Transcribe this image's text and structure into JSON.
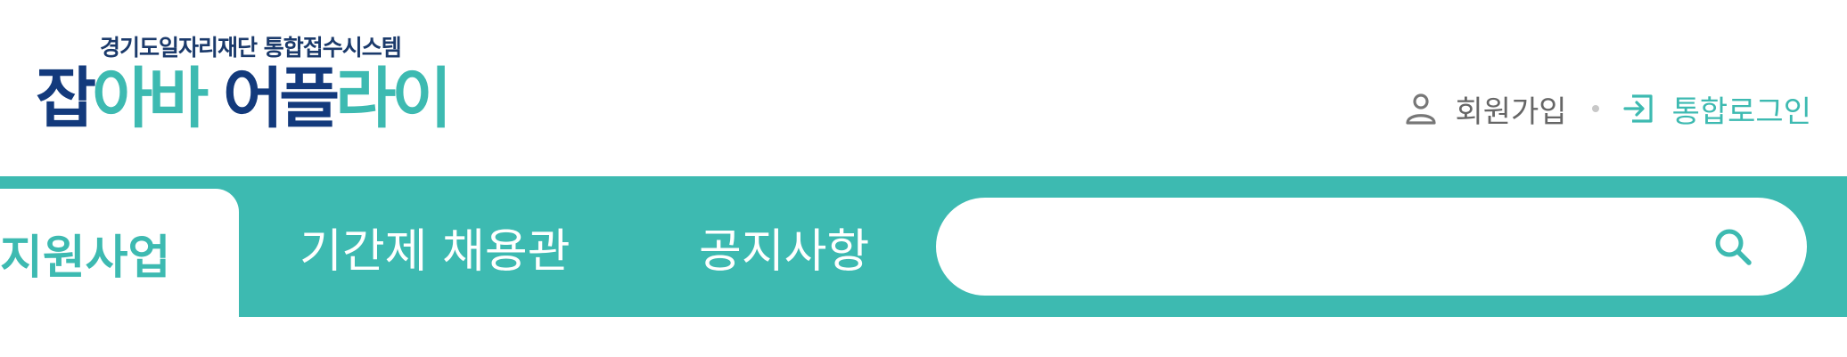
{
  "logo": {
    "subtitle": "경기도일자리재단 통합접수시스템",
    "parts": [
      "잡",
      "아바",
      "어플",
      "라이"
    ],
    "colors": {
      "navy": "#133a7c",
      "teal": "#3dbab1"
    }
  },
  "util": {
    "join_label": "회원가입",
    "join_icon": "user-icon",
    "login_label": "통합로그인",
    "login_icon": "login-icon"
  },
  "nav": {
    "tabs": [
      {
        "label": "지원사업",
        "active": true
      },
      {
        "label": "기간제 채용관",
        "active": false
      },
      {
        "label": "공지사항",
        "active": false
      }
    ]
  },
  "search": {
    "value": "",
    "placeholder": "",
    "icon": "search-icon"
  },
  "colors": {
    "accent": "#3dbab1",
    "text_gray": "#666666"
  }
}
